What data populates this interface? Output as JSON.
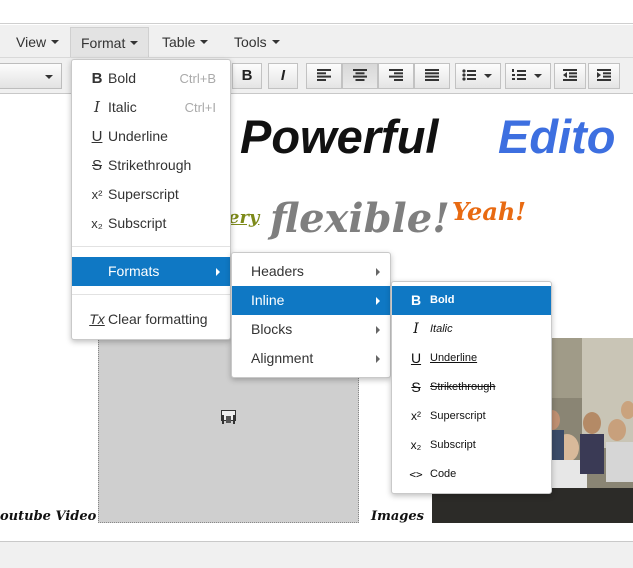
{
  "menubar": {
    "items": [
      {
        "label": "View"
      },
      {
        "label": "Format"
      },
      {
        "label": "Table"
      },
      {
        "label": "Tools"
      }
    ]
  },
  "toolbar": {
    "bold_label": "B",
    "italic_label": "I"
  },
  "content": {
    "headline_black": "Powerful",
    "headline_blue": "Edito",
    "very": "ery",
    "flexible": "flexible!",
    "yeah": "Yeah!",
    "caption_video": "outube Video",
    "caption_images": "Images"
  },
  "format_menu": {
    "items": [
      {
        "icon": "B",
        "label": "Bold",
        "shortcut": "Ctrl+B"
      },
      {
        "icon": "I",
        "label": "Italic",
        "shortcut": "Ctrl+I"
      },
      {
        "icon": "U",
        "label": "Underline",
        "shortcut": ""
      },
      {
        "icon": "S",
        "label": "Strikethrough",
        "shortcut": ""
      },
      {
        "icon": "x²",
        "label": "Superscript",
        "shortcut": ""
      },
      {
        "icon": "x₂",
        "label": "Subscript",
        "shortcut": ""
      },
      {
        "icon": "",
        "label": "Formats",
        "shortcut": ""
      },
      {
        "icon": "Tx",
        "label": "Clear formatting",
        "shortcut": ""
      }
    ]
  },
  "formats_submenu": {
    "items": [
      {
        "label": "Headers"
      },
      {
        "label": "Inline"
      },
      {
        "label": "Blocks"
      },
      {
        "label": "Alignment"
      }
    ]
  },
  "inline_submenu": {
    "items": [
      {
        "icon": "B",
        "label": "Bold"
      },
      {
        "icon": "I",
        "label": "Italic"
      },
      {
        "icon": "U",
        "label": "Underline"
      },
      {
        "icon": "S",
        "label": "Strikethrough"
      },
      {
        "icon": "x²",
        "label": "Superscript"
      },
      {
        "icon": "x₂",
        "label": "Subscript"
      },
      {
        "icon": "<>",
        "label": "Code"
      }
    ]
  },
  "colors": {
    "accent": "#0f78c4",
    "headline_blue": "#3d6fe0",
    "flexible_gray": "#7f7f7f",
    "yeah_orange": "#e86a12",
    "very_olive": "#7d8a1a"
  }
}
